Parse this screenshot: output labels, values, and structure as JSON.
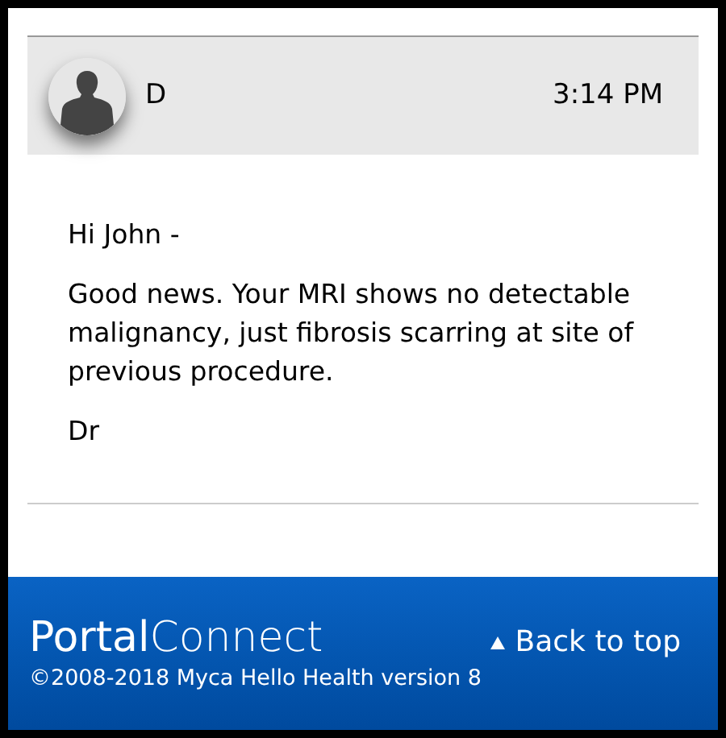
{
  "message": {
    "sender": "D",
    "time": "3:14 PM",
    "body": [
      "Hi John -",
      "Good news. Your MRI shows no detectable malignancy, just fibrosis scarring at site of previous procedure.",
      "Dr"
    ]
  },
  "footer": {
    "logo": "**Portal**Connect",
    "copyright": "©2008-2018 Myca Hello Health version 8",
    "back_to_top": "Back to top"
  }
}
